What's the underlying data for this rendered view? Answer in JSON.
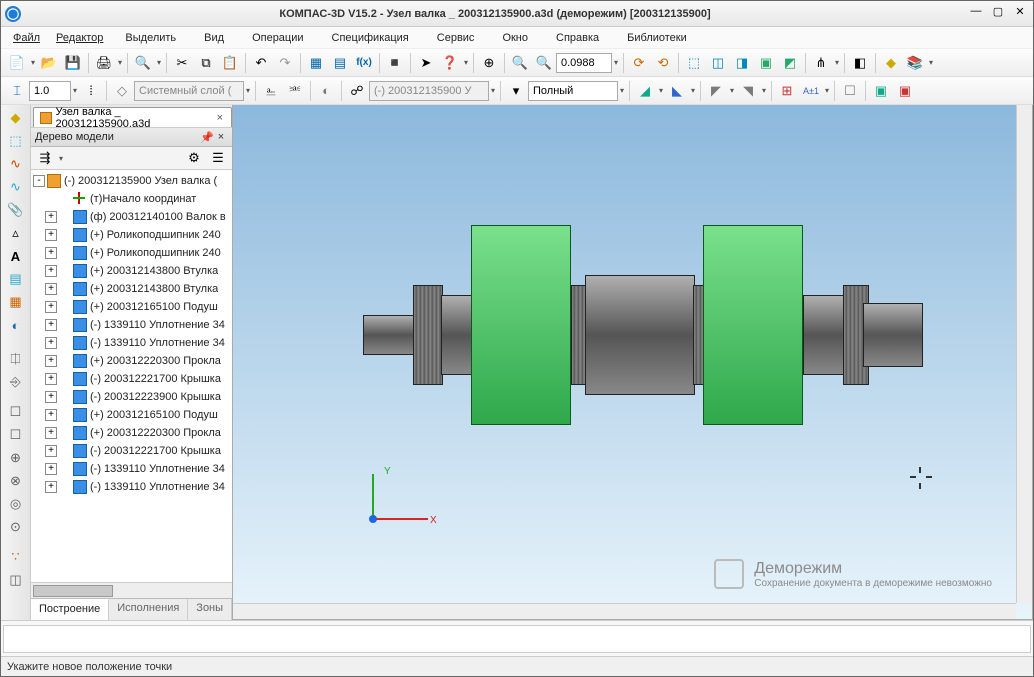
{
  "title": "КОМПАС-3D V15.2  - Узел валка _ 200312135900.a3d (деморежим) [200312135900]",
  "menu": [
    "Файл",
    "Редактор",
    "Выделить",
    "Вид",
    "Операции",
    "Спецификация",
    "Сервис",
    "Окно",
    "Справка",
    "Библиотеки"
  ],
  "toolbar2": {
    "lineScale": "1.0",
    "layer": "Системный слой (",
    "docRef": "(-) 200312135900 У",
    "viewMode": "Полный"
  },
  "zoom": "0.0988",
  "docTab": "Узел валка _ 200312135900.a3d",
  "panel": {
    "title": "Дерево модели",
    "tabs": [
      "Построение",
      "Исполнения",
      "Зоны"
    ]
  },
  "tree": {
    "root": "(-) 200312135900 Узел валка (",
    "origin": "(т)Начало координат",
    "items": [
      "(ф) 200312140100 Валок в",
      "(+) Роликоподшипник 240",
      "(+) Роликоподшипник 240",
      "(+) 200312143800 Втулка",
      "(+) 200312143800 Втулка",
      "(+) 200312165100 Подуш",
      "(-) 1339110 Уплотнение 34",
      "(-) 1339110 Уплотнение 34",
      "(+) 200312220300 Прокла",
      "(-) 200312221700 Крышка",
      "(-) 200312223900 Крышка",
      "(+) 200312165100 Подуш",
      "(+) 200312220300 Прокла",
      "(-) 200312221700 Крышка",
      "(-) 1339110 Уплотнение 34",
      "(-) 1339110 Уплотнение 34"
    ]
  },
  "triad": {
    "x": "X",
    "y": "Y"
  },
  "demo": {
    "title": "Деморежим",
    "sub": "Сохранение документа в деморежиме невозможно"
  },
  "status": "Укажите новое положение точки"
}
